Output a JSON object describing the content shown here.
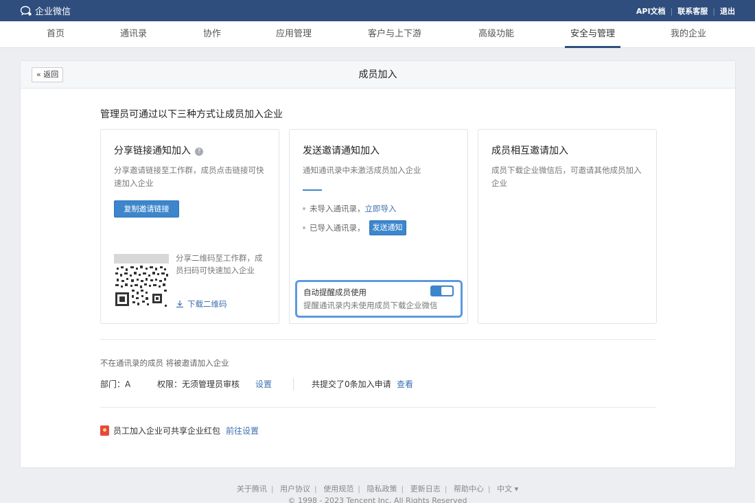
{
  "topbar": {
    "app_name": "企业微信",
    "links": [
      "API文档",
      "联系客服",
      "退出"
    ]
  },
  "nav": {
    "items": [
      "首页",
      "通讯录",
      "协作",
      "应用管理",
      "客户与上下游",
      "高级功能",
      "安全与管理",
      "我的企业"
    ],
    "active": "安全与管理"
  },
  "page": {
    "back_label": "« 返回",
    "title": "成员加入",
    "intro": "管理员可通过以下三种方式让成员加入企业"
  },
  "options": {
    "share": {
      "title": "分享链接通知加入",
      "desc": "分享邀请链接至工作群，成员点击链接可快速加入企业",
      "copy_button": "复制邀请链接",
      "qr_text": "分享二维码至工作群，成员扫码可快速加入企业",
      "download_qr": "下载二维码"
    },
    "invite": {
      "title": "发送邀请通知加入",
      "desc": "通知通讯录中未激活成员加入企业",
      "bullet1_text": "未导入通讯录，",
      "bullet1_link": "立即导入",
      "bullet2_text": "已导入通讯录，",
      "send_button": "发送通知",
      "remind_title": "自动提醒成员使用",
      "remind_desc": "提醒通讯录内未使用成员下载企业微信",
      "remind_enabled": true
    },
    "mutual": {
      "title": "成员相互邀请加入",
      "desc": "成员下载企业微信后，可邀请其他成员加入企业"
    }
  },
  "settings": {
    "note": "不在通讯录的成员 将被邀请加入企业",
    "dept_label": "部门：A",
    "perm_label": "权限：无须管理员审核",
    "perm_link": "设置",
    "apply_text": "共提交了0条加入申请",
    "apply_link": "查看"
  },
  "redpacket": {
    "text": "员工加入企业可共享企业红包",
    "link": "前往设置"
  },
  "footer": {
    "links": [
      "关于腾讯",
      "用户协议",
      "使用规范",
      "隐私政策",
      "更新日志",
      "帮助中心",
      "中文 ▾"
    ],
    "copyright": "© 1998 - 2023 Tencent Inc. All Rights Reserved"
  },
  "colors": {
    "topbar": "#2f4e7d",
    "primary": "#3d86cc",
    "highlight_border": "#5b9ae0",
    "link": "#3d6fb0"
  }
}
